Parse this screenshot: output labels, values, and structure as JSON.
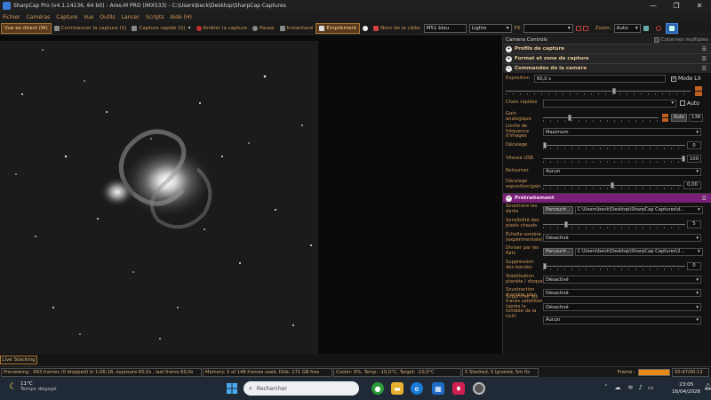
{
  "window": {
    "title": "SharpCap Pro (v4.1.14136, 64 bit) - Ares-M PRO (IMX533) - C:\\Users\\beck\\Desktop\\SharpCap Captures",
    "controls": [
      "—",
      "❐",
      "✕"
    ]
  },
  "menu": [
    "Fichier",
    "Caméras",
    "Capture",
    "Vue",
    "Outils",
    "Lancer",
    "Scripts",
    "Aide (H)"
  ],
  "toolbar": {
    "live": "Vue en direct (W)",
    "start_capture": "Commencer la capture (S)",
    "quick_capture": "Capture rapide (Q)",
    "stop_capture": "Arrêter la capture",
    "pause": "Pause",
    "snapshot": "Instantané",
    "stack": "Empilement",
    "target_label": "Nom de la cible:",
    "target_value": "M51 bleu",
    "frame_type": "Lights",
    "fx_label": "FX",
    "zoom_label": "Zoom:",
    "zoom_value": "Auto"
  },
  "panel": {
    "header": "Camera Controls",
    "multi_columns": "Colonnes multiples",
    "sections": {
      "capture_profiles": "Profils de capture",
      "format_zone": "Format et zone de capture",
      "camera_controls": "Commandes de la caméra",
      "preprocessing": "Prétraitement"
    },
    "exposure": {
      "label": "Exposition",
      "value": "60,0 s",
      "lx_label": "Mode LX",
      "lx_checked": "✓"
    },
    "quick_choice": {
      "label": "Choix rapides",
      "auto": "Auto"
    },
    "gain": {
      "label": "Gain analogique",
      "auto_btn": "Auto",
      "value": "138"
    },
    "frame_rate_limit": {
      "label": "Limite de fréquence d'images",
      "value": "Maximum"
    },
    "offset": {
      "label": "Décalage",
      "value": "0"
    },
    "usb_speed": {
      "label": "Vitesse USB",
      "value": "100"
    },
    "flip": {
      "label": "Retourner",
      "value": "Aucun"
    },
    "exposure_gain_offset": {
      "label": "Décalage exposition/gain",
      "value": "0,00"
    },
    "subtract_darks": {
      "label": "Soustraire les darks",
      "button": "Parcourir...",
      "path": "C:\\Users\\beck\\Desktop\\SharpCap Captures\\d..."
    },
    "hot_pixel": {
      "label": "Sensibilité des pixels chauds",
      "value": "5"
    },
    "dark_scale": {
      "label": "Échelle sombre (expérimentale)",
      "value": "Désactivé"
    },
    "divide_flats": {
      "label": "Diviser par les flats",
      "button": "Parcourir...",
      "path": "C:\\Users\\beck\\Desktop\\SharpCap Captures\\2..."
    },
    "banding": {
      "label": "Suppression des bandes",
      "value": "0"
    },
    "planet_stab": {
      "label": "Stabilisation planète / disque",
      "value": "Désactivé"
    },
    "bg_subtract": {
      "label": "Soustraction d'arrière plan",
      "value": "Désactivé"
    },
    "satellite": {
      "label": "Supprimer les traces satellites (après la tombée de la nuit)",
      "value": "Désactivé"
    },
    "last": {
      "value": "Aucun"
    }
  },
  "live_stacking": "Live Stacking",
  "status": {
    "preview": "Previewing : 693 frames (0 dropped) in 1:06:18, exposure 60,0s , last frame 60,0s",
    "memory": "Memory: 5 of 148 frames used, Disk: 271 GB free",
    "cooler": "Cooler: 9%, Temp: -10,0°C, Target: -10,0°C",
    "stacked": "5 Stacked, 0 Ignored, 5m 0s",
    "frame_label": "Frame :",
    "frame_progress": 1.0,
    "frame_time": "00:47/00:13"
  },
  "taskbar": {
    "weather_temp": "11°C",
    "weather_desc": "Temps dégagé",
    "search_placeholder": "Rechercher",
    "time": "23:05",
    "date": "16/04/2026"
  },
  "colors": {
    "accent": "#d09a5a",
    "preprocess_header": "#7a1f78",
    "progress": "#e88a1a"
  }
}
